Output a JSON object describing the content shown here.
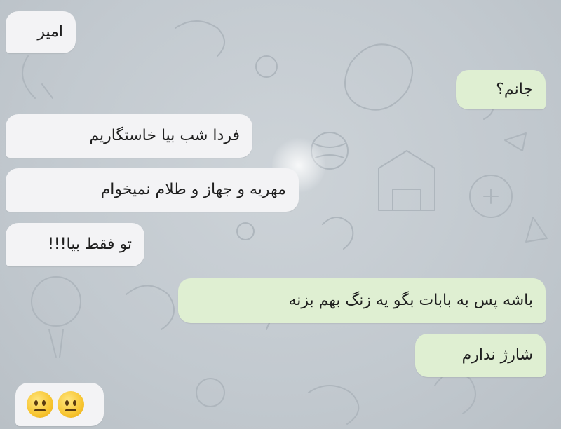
{
  "messages": [
    {
      "text": "امیر"
    },
    {
      "text": "جانم؟"
    },
    {
      "text": "فردا شب بیا خاستگاریم"
    },
    {
      "text": "مهریه و جهاز و طلام نمیخوام"
    },
    {
      "text": "تو فقط بیا!!!"
    },
    {
      "text": "باشه پس به بابات بگو یه زنگ بهم بزنه"
    },
    {
      "text": "شارژ ندارم"
    }
  ],
  "emoji_message": {
    "icons": [
      "neutral-face-icon",
      "neutral-face-icon"
    ]
  },
  "colors": {
    "incoming_bubble": "#f3f3f5",
    "outgoing_bubble": "#dfefd2",
    "chat_background": "#c4cbd1",
    "text": "#1f1f1f"
  }
}
